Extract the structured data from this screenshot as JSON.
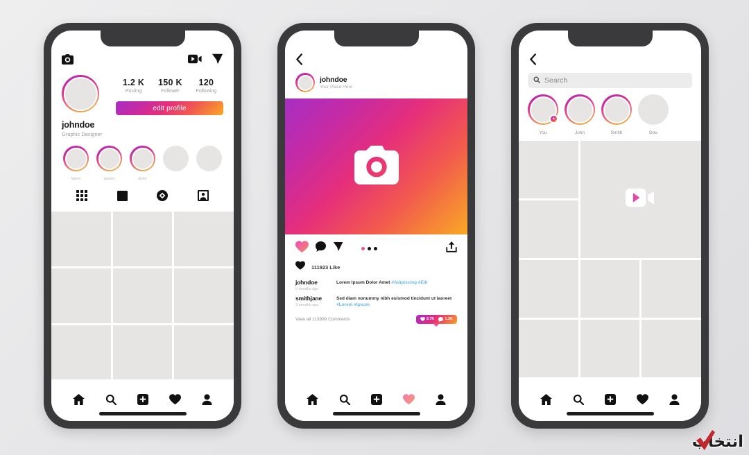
{
  "background": {
    "page_bg": "#e8e8ea",
    "frame_color": "#3a3a3c"
  },
  "brand": {
    "gradient_start": "#a72fc4",
    "gradient_mid": "#e62e7b",
    "gradient_end": "#f9a825",
    "accent_pink": "#ec4a8e"
  },
  "phone1": {
    "screen_name": "profile-screen",
    "topbar": {
      "camera_icon": "camera-icon",
      "igtv_icon": "video-camera-icon",
      "send_icon": "send-icon"
    },
    "profile": {
      "username": "johndoe",
      "bio": "Graphic Designer",
      "avatar": "profile-avatar"
    },
    "stats": [
      {
        "value": "1.2 K",
        "label": "Posting"
      },
      {
        "value": "150 K",
        "label": "Follower"
      },
      {
        "value": "120",
        "label": "Following"
      }
    ],
    "edit_button": "edit profile",
    "highlights": [
      {
        "label": "lorem",
        "has_ring": true
      },
      {
        "label": "ipsum",
        "has_ring": true
      },
      {
        "label": "dolor",
        "has_ring": true
      },
      {
        "label": "",
        "has_ring": false
      },
      {
        "label": "",
        "has_ring": false
      }
    ],
    "tabs": [
      {
        "icon": "grid-icon",
        "active": true
      },
      {
        "icon": "square-icon",
        "active": false
      },
      {
        "icon": "igtv-badge-icon",
        "active": false
      },
      {
        "icon": "tagged-photo-icon",
        "active": false
      }
    ],
    "nav": [
      {
        "icon": "home-icon",
        "active": false
      },
      {
        "icon": "search-icon",
        "active": false
      },
      {
        "icon": "add-post-icon",
        "active": false
      },
      {
        "icon": "heart-icon",
        "active": false
      },
      {
        "icon": "person-icon",
        "active": false
      }
    ]
  },
  "phone2": {
    "screen_name": "post-detail-screen",
    "back_icon": "chevron-left-icon",
    "post_author": {
      "username": "johndoe",
      "subtitle": "Your Place Here"
    },
    "photo": {
      "placeholder_icon": "camera-icon"
    },
    "actions": {
      "like_icon": "heart-icon",
      "comment_icon": "comment-icon",
      "send_icon": "send-icon",
      "share_icon": "share-upload-icon",
      "dots": 3
    },
    "likes_text": "111923 Like",
    "comments": [
      {
        "username": "johndoe",
        "time": "5 months ago",
        "text": "Lorem Ipsum Dolor Amet ",
        "tags": "#Adipiscing #Elit"
      },
      {
        "username": "smithjane",
        "time": "3 months ago",
        "text": "Sed diam nonummy nibh euismod tincidunt ut laoreet ",
        "tags": "#Lorem #Ipsum"
      }
    ],
    "view_all": "View all 113999 Comments",
    "badge": {
      "likes": "3.7K",
      "comments": "1.2K"
    },
    "nav": [
      {
        "icon": "home-icon",
        "active": false
      },
      {
        "icon": "search-icon",
        "active": false
      },
      {
        "icon": "add-post-icon",
        "active": false
      },
      {
        "icon": "heart-icon",
        "active": true
      },
      {
        "icon": "person-icon",
        "active": false
      }
    ]
  },
  "phone3": {
    "screen_name": "explore-screen",
    "back_icon": "chevron-left-icon",
    "search": {
      "placeholder": "Search",
      "icon": "search-icon"
    },
    "stories": [
      {
        "label": "You",
        "has_ring": true,
        "has_plus": true
      },
      {
        "label": "John",
        "has_ring": true,
        "has_plus": false
      },
      {
        "label": "Smith",
        "has_ring": true,
        "has_plus": false
      },
      {
        "label": "Doe",
        "has_ring": false,
        "has_plus": false
      }
    ],
    "grid": {
      "featured_tile_icon": "video-camera-icon",
      "featured_position": "top-right-2x2"
    },
    "nav": [
      {
        "icon": "home-icon",
        "active": false
      },
      {
        "icon": "search-icon",
        "active": false
      },
      {
        "icon": "add-post-icon",
        "active": false
      },
      {
        "icon": "heart-icon",
        "active": false
      },
      {
        "icon": "person-icon",
        "active": false
      }
    ]
  },
  "watermark": {
    "text": "انتخاب",
    "check_icon": "red-check-icon",
    "check_color": "#c0282d"
  }
}
